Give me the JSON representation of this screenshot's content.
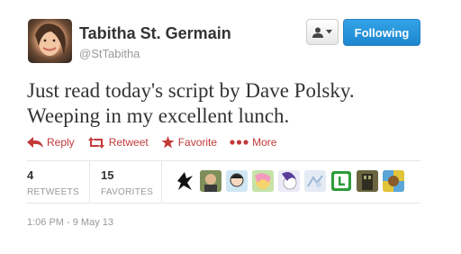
{
  "author": {
    "name": "Tabitha St. Germain",
    "handle": "@StTabitha",
    "avatar_icon": "avatar-photo"
  },
  "header": {
    "user_menu_icon": "user-dropdown-icon",
    "follow_label": "Following"
  },
  "tweet": {
    "text_line1": "Just read today's script by Dave Polsky.",
    "text_line2": "Weeping in my excellent lunch."
  },
  "actions": {
    "reply": "Reply",
    "retweet": "Retweet",
    "favorite": "Favorite",
    "more": "More"
  },
  "stats": {
    "retweets_count": "4",
    "retweets_label": "RETWEETS",
    "favorites_count": "15",
    "favorites_label": "FAVORITES"
  },
  "favoriters": [
    {
      "icon": "favoriter-avatar-1"
    },
    {
      "icon": "favoriter-avatar-2"
    },
    {
      "icon": "favoriter-avatar-3"
    },
    {
      "icon": "favoriter-avatar-4"
    },
    {
      "icon": "favoriter-avatar-5"
    },
    {
      "icon": "favoriter-avatar-6"
    },
    {
      "icon": "favoriter-avatar-7"
    },
    {
      "icon": "favoriter-avatar-8"
    },
    {
      "icon": "favoriter-avatar-9"
    }
  ],
  "timestamp": "1:06 PM - 9 May 13",
  "colors": {
    "action_red": "#c33a3a",
    "follow_blue": "#2b9ae0",
    "muted_gray": "#999999"
  }
}
